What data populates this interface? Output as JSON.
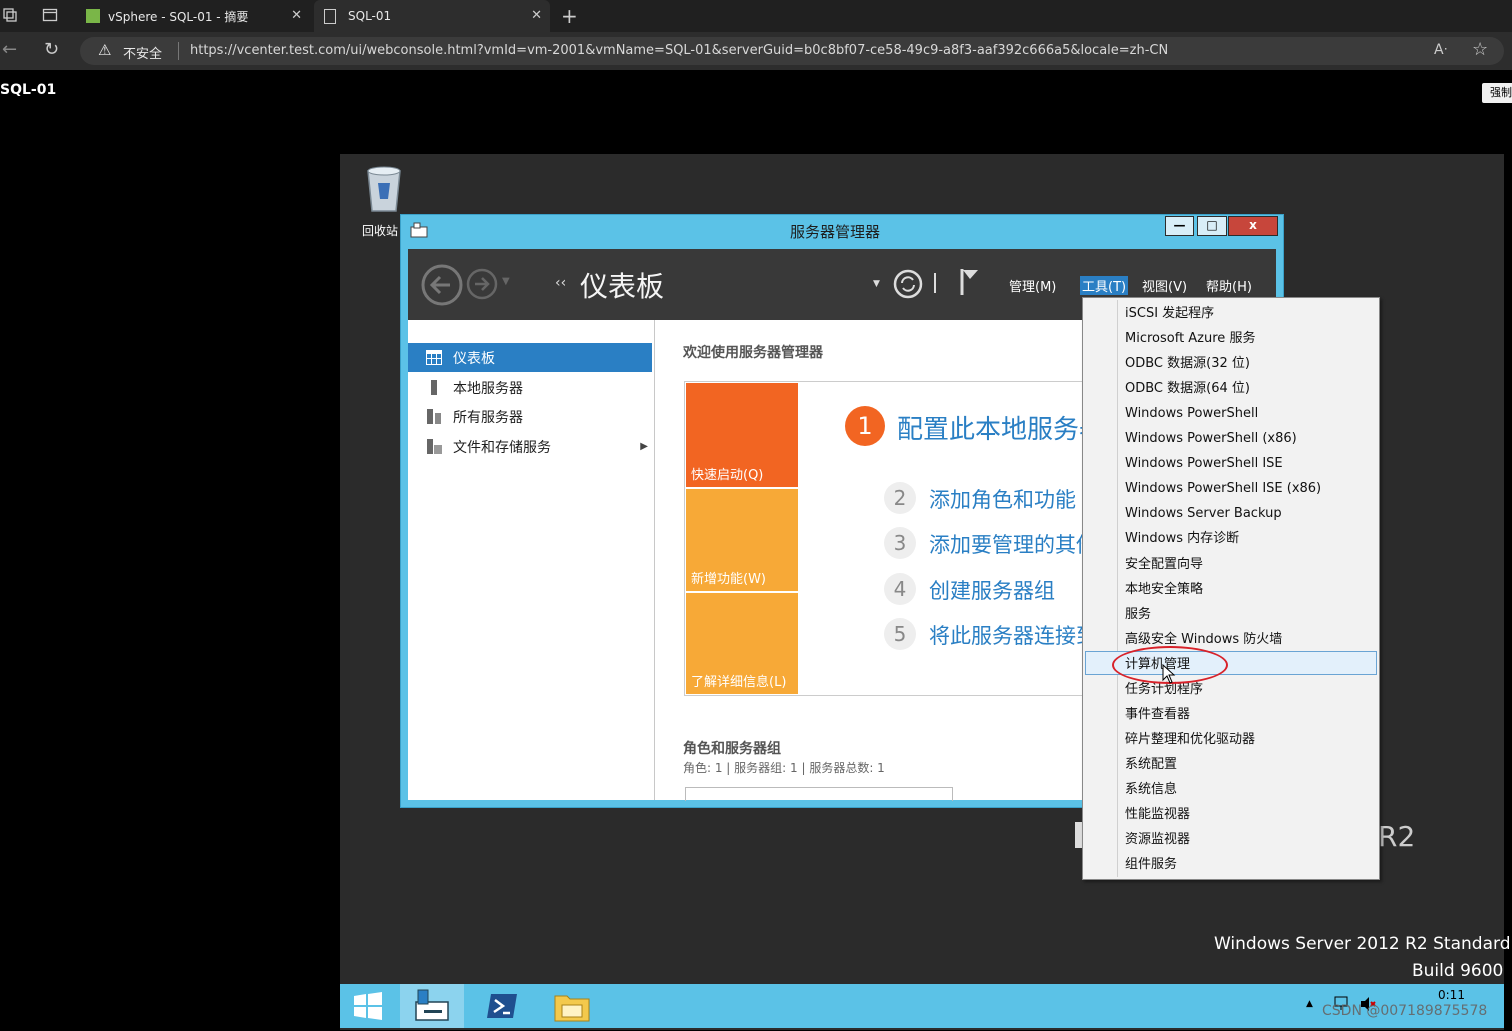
{
  "browser": {
    "tabs": [
      {
        "title": "vSphere - SQL-01 - 摘要"
      },
      {
        "title": "SQL-01"
      }
    ],
    "security_label": "不安全",
    "url": "https://vcenter.test.com/ui/webconsole.html?vmId=vm-2001&vmName=SQL-01&serverGuid=b0c8bf07-ce58-49c9-a8f3-aaf392c666a5&locale=zh-CN",
    "vm_name": "SQL-01",
    "force_button": "强制"
  },
  "desktop": {
    "recycle_bin_label": "回收站",
    "watermark_line1": "Windows Server 2012 R2 Standard",
    "watermark_line2": "Build 9600",
    "r2_text": "R2"
  },
  "server_manager": {
    "title": "服务器管理器",
    "window_buttons": {
      "minimize": "—",
      "maximize": "□",
      "close": "x"
    },
    "breadcrumb": "仪表板",
    "menus": [
      "管理(M)",
      "工具(T)",
      "视图(V)",
      "帮助(H)"
    ],
    "nav": [
      "仪表板",
      "本地服务器",
      "所有服务器",
      "文件和存储服务"
    ],
    "welcome": "欢迎使用服务器管理器",
    "quickstart": [
      "快速启动(Q)",
      "新增功能(W)",
      "了解详细信息(L)"
    ],
    "steps": [
      {
        "num": "1",
        "text": "配置此本地服务器"
      },
      {
        "num": "2",
        "text": "添加角色和功能"
      },
      {
        "num": "3",
        "text": "添加要管理的其他服务器"
      },
      {
        "num": "4",
        "text": "创建服务器组"
      },
      {
        "num": "5",
        "text": "将此服务器连接到云服务"
      }
    ],
    "roles_title": "角色和服务器组",
    "roles_sub": "角色: 1 | 服务器组: 1 | 服务器总数: 1"
  },
  "tools_menu": {
    "items": [
      "iSCSI 发起程序",
      "Microsoft Azure 服务",
      "ODBC 数据源(32 位)",
      "ODBC 数据源(64 位)",
      "Windows PowerShell",
      "Windows PowerShell (x86)",
      "Windows PowerShell ISE",
      "Windows PowerShell ISE (x86)",
      "Windows Server Backup",
      "Windows 内存诊断",
      "安全配置向导",
      "本地安全策略",
      "服务",
      "高级安全 Windows 防火墙",
      "计算机管理",
      "任务计划程序",
      "事件查看器",
      "碎片整理和优化驱动器",
      "系统配置",
      "系统信息",
      "性能监视器",
      "资源监视器",
      "组件服务"
    ],
    "highlighted": "计算机管理"
  },
  "taskbar": {
    "clock_time": "0:11",
    "csdn_watermark": "CSDN @007189875578"
  }
}
